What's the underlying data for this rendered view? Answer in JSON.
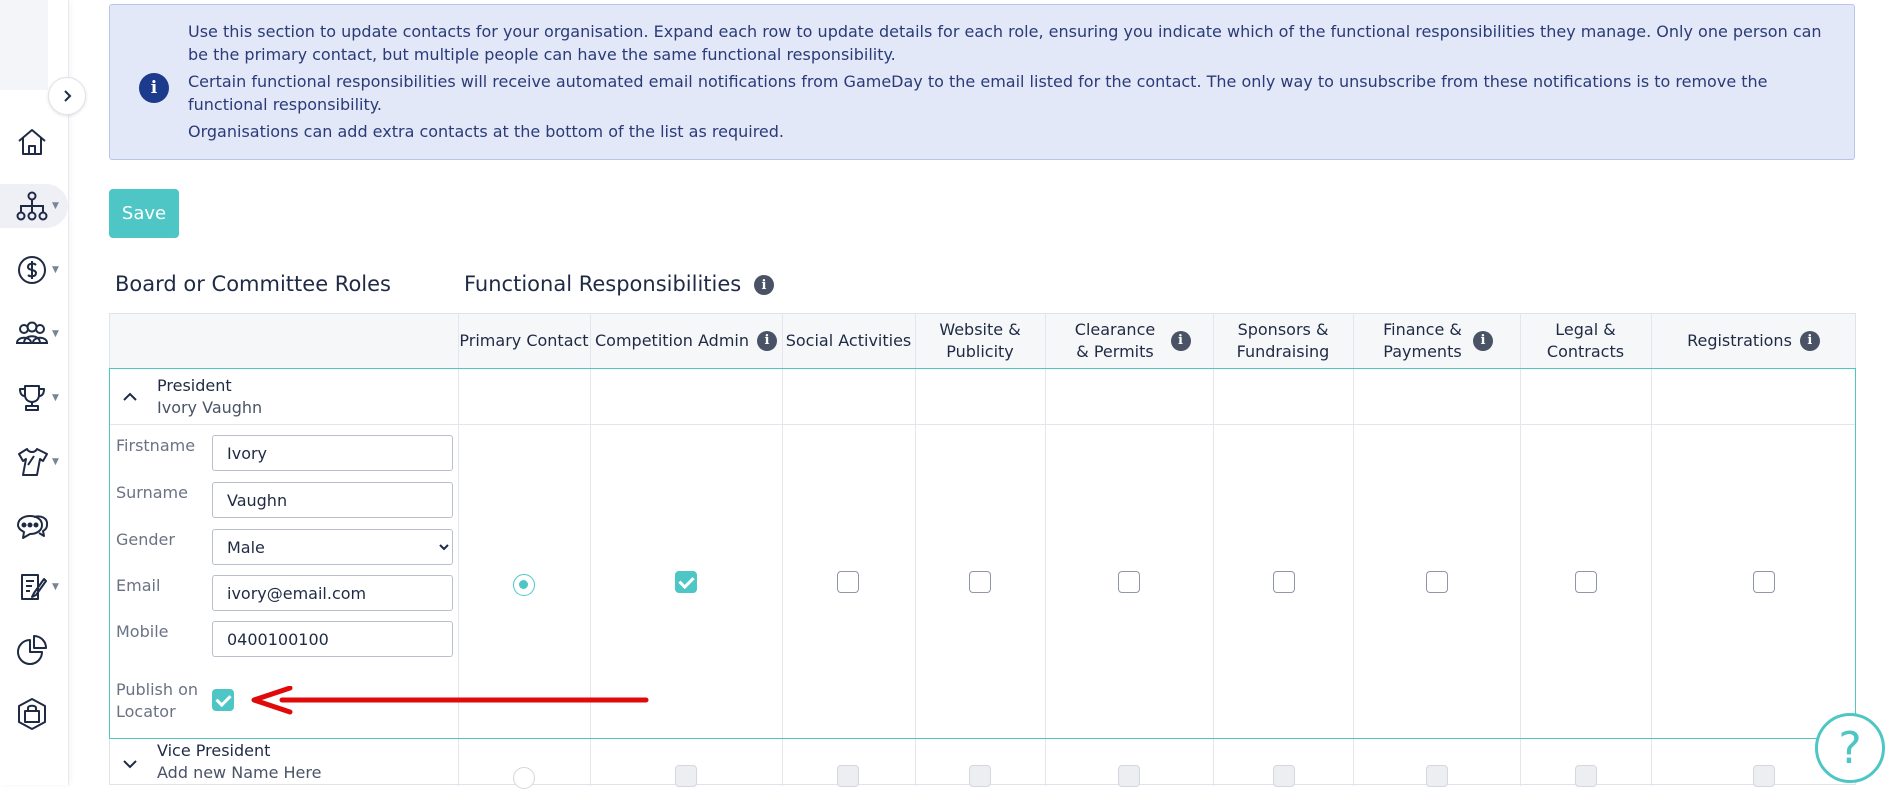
{
  "info": {
    "p1": "Use this section to update contacts for your organisation. Expand each row to update details for each role, ensuring you indicate which of the functional responsibilities they manage. Only one person can be the primary contact, but multiple people can have the same functional responsibility.",
    "p2": "Certain functional responsibilities will receive automated email notifications from GameDay to the email listed for the contact. The only way to unsubscribe from these notifications is to remove the functional responsibility.",
    "p3": "Organisations can add extra contacts at the bottom of the list as required."
  },
  "toolbar": {
    "save_label": "Save"
  },
  "headings": {
    "roles": "Board or Committee Roles",
    "responsibilities": "Functional Responsibilities"
  },
  "columns": [
    {
      "label": "Primary Contact",
      "info": false
    },
    {
      "label": "Competition Admin",
      "info": true
    },
    {
      "label": "Social Activities",
      "info": false
    },
    {
      "label": "Website & Publicity",
      "info": false
    },
    {
      "label": "Clearance & Permits",
      "info": true
    },
    {
      "label": "Sponsors & Fundraising",
      "info": false
    },
    {
      "label": "Finance & Payments",
      "info": true
    },
    {
      "label": "Legal & Contracts",
      "info": false
    },
    {
      "label": "Registrations",
      "info": true
    }
  ],
  "president": {
    "role": "President",
    "name": "Ivory Vaughn",
    "labels": {
      "firstname": "Firstname",
      "surname": "Surname",
      "gender": "Gender",
      "email": "Email",
      "mobile": "Mobile",
      "publish": "Publish on Locator"
    },
    "values": {
      "firstname": "Ivory",
      "surname": "Vaughn",
      "gender": "Male",
      "email": "ivory@email.com",
      "mobile": "0400100100"
    },
    "gender_options": [
      "Male"
    ],
    "publish_checked": true,
    "primary_contact": true,
    "responsibilities_checked": [
      true,
      false,
      false,
      false,
      false,
      false,
      false,
      false
    ]
  },
  "vice_president": {
    "role": "Vice President",
    "name": "Add new Name Here"
  },
  "colors": {
    "accent": "#4ec6c6",
    "info_bg": "#e3e8f8",
    "arrow": "#e10a0a"
  },
  "icons": [
    "home-icon",
    "org-chart-icon",
    "dollar-icon",
    "people-icon",
    "trophy-icon",
    "jersey-icon",
    "chat-icon",
    "form-icon",
    "pie-chart-icon",
    "shopping-bag-icon",
    "help-icon"
  ]
}
